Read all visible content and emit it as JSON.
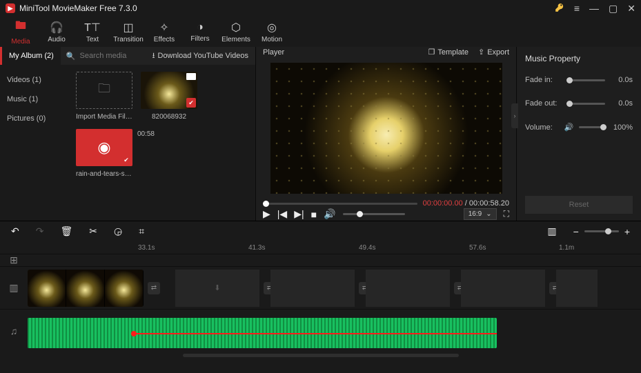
{
  "app": {
    "title": "MiniTool MovieMaker Free 7.3.0"
  },
  "toolbar": {
    "media": "Media",
    "audio": "Audio",
    "text": "Text",
    "transition": "Transition",
    "effects": "Effects",
    "filters": "Filters",
    "elements": "Elements",
    "motion": "Motion"
  },
  "media": {
    "album_label": "My Album (2)",
    "search_placeholder": "Search media",
    "download_yt": "Download YouTube Videos",
    "categories": {
      "videos": "Videos (1)",
      "music": "Music (1)",
      "pictures": "Pictures (0)"
    },
    "import_label": "Import Media Files",
    "video_name": "820068932",
    "audio_name": "rain-and-tears-sad-...",
    "audio_duration": "00:58"
  },
  "player": {
    "title": "Player",
    "template": "Template",
    "export": "Export",
    "time_current": "00:00:00.00",
    "time_total": "00:00:58.20",
    "aspect": "16:9"
  },
  "props": {
    "title": "Music Property",
    "fade_in_label": "Fade in:",
    "fade_in_value": "0.0s",
    "fade_out_label": "Fade out:",
    "fade_out_value": "0.0s",
    "volume_label": "Volume:",
    "volume_value": "100%",
    "reset": "Reset"
  },
  "timeline": {
    "ruler": [
      "33.1s",
      "41.3s",
      "49.4s",
      "57.6s",
      "1.1m"
    ]
  }
}
